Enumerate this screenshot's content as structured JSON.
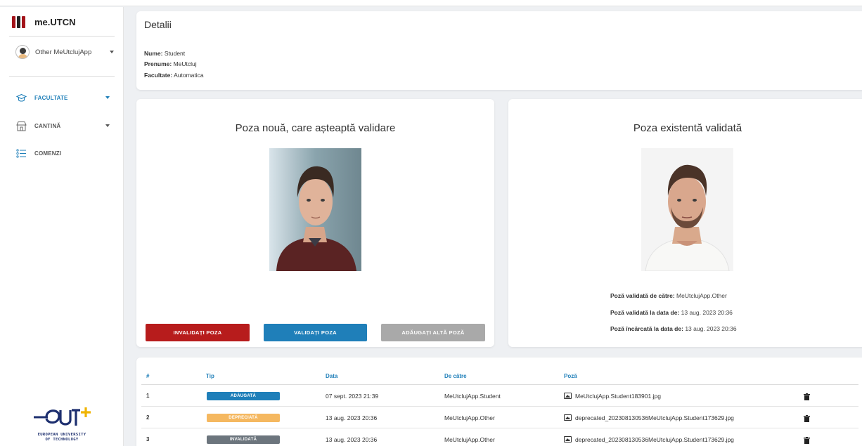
{
  "brand": {
    "name": "me.UTCN"
  },
  "user": {
    "name": "Other MeUtclujApp"
  },
  "nav": {
    "items": [
      {
        "label": "FACULTATE",
        "icon": "graduation-cap-icon",
        "active": true,
        "has_caret": true
      },
      {
        "label": "CANTINĂ",
        "icon": "canteen-icon",
        "active": false,
        "has_caret": true
      },
      {
        "label": "COMENZI",
        "icon": "list-icon",
        "active": false,
        "has_caret": false
      }
    ]
  },
  "footer_logo": {
    "text_line1": "EUROPEAN UNIVERSITY",
    "text_line2": "OF TECHNOLOGY"
  },
  "details": {
    "title": "Detalii",
    "nume_label": "Nume:",
    "nume_value": "Student",
    "prenume_label": "Prenume:",
    "prenume_value": "MeUtcluj",
    "facultate_label": "Facultate:",
    "facultate_value": "Automatica"
  },
  "new_photo": {
    "title": "Poza nouă, care așteaptă validare",
    "invalidate_label": "INVALIDAȚI POZA",
    "validate_label": "VALIDAȚI POZA",
    "add_label": "ADĂUGAȚI ALTĂ POZĂ"
  },
  "existing_photo": {
    "title": "Poza existentă validată",
    "validated_by_label": "Poză validată de către:",
    "validated_by_value": "MeUtclujApp.Other",
    "validated_at_label": "Poză validată la data de:",
    "validated_at_value": "13 aug. 2023 20:36",
    "uploaded_at_label": "Poză încărcată la data de:",
    "uploaded_at_value": "13 aug. 2023 20:36"
  },
  "table": {
    "headers": [
      "#",
      "Tip",
      "Data",
      "De către",
      "Poză"
    ],
    "rows": [
      {
        "num": "1",
        "tip": "ADĂUGATĂ",
        "tip_color": "#1f7fb9",
        "data": "07 sept. 2023 21:39",
        "by": "MeUtclujApp.Student",
        "file": "MeUtclujApp.Student183901.jpg"
      },
      {
        "num": "2",
        "tip": "DEPRECIATĂ",
        "tip_color": "#f5b860",
        "data": "13 aug. 2023 20:36",
        "by": "MeUtclujApp.Other",
        "file": "deprecated_202308130536MeUtclujApp.Student173629.jpg"
      },
      {
        "num": "3",
        "tip": "INVALIDATĂ",
        "tip_color": "#6c757d",
        "data": "13 aug. 2023 20:36",
        "by": "MeUtclujApp.Other",
        "file": "deprecated_202308130536MeUtclujApp.Student173629.jpg"
      }
    ]
  }
}
